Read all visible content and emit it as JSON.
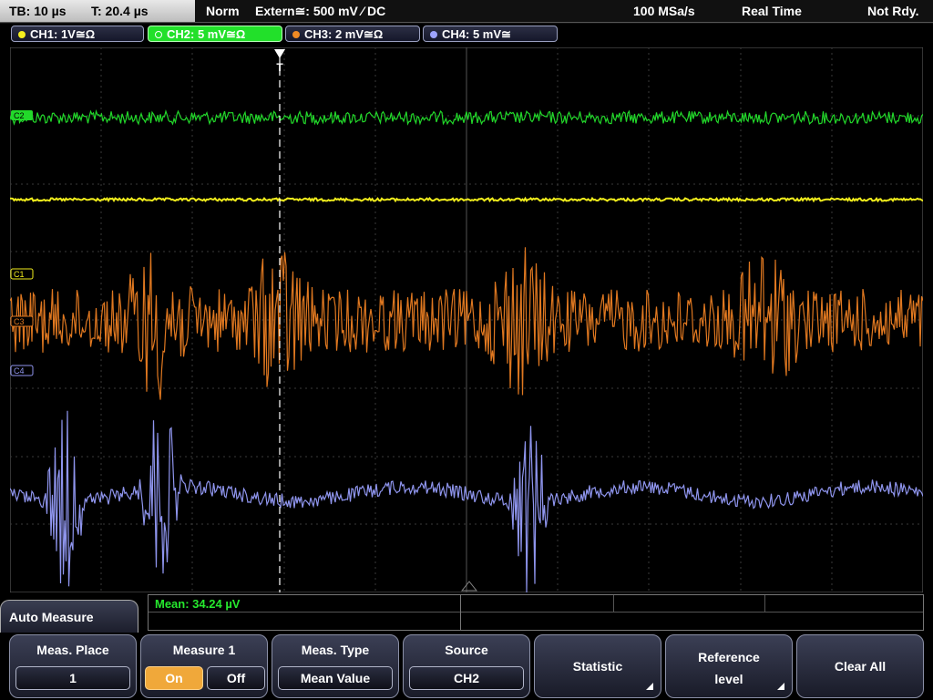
{
  "top": {
    "tb": "TB: 10 µs",
    "trigger_time": "T: 20.4 µs",
    "mode": "Norm",
    "trigger_source": "Extern≅: 500 mV ⁄ DC",
    "sample_rate": "100 MSa/s",
    "acq_mode": "Real Time",
    "status": "Not Rdy."
  },
  "channels": [
    {
      "label": "CH1: 1V≅Ω",
      "color": "#f5ef1e",
      "active": false
    },
    {
      "label": "CH2: 5 mV≅Ω",
      "color": "#22e02a",
      "active": true
    },
    {
      "label": "CH3: 2 mV≅Ω",
      "color": "#f08a24",
      "active": false
    },
    {
      "label": "CH4: 5 mV≅",
      "color": "#9da3ff",
      "active": false
    }
  ],
  "markers": {
    "c2": "C2",
    "c1": "C1",
    "c3": "C3",
    "c4": "C4",
    "trigger": "T"
  },
  "measurement": {
    "mean": "Mean: 34.24 µV"
  },
  "menu": {
    "title": "Auto Measure",
    "meas_place": {
      "title": "Meas. Place",
      "value": "1"
    },
    "measure1": {
      "title": "Measure 1",
      "on": "On",
      "off": "Off"
    },
    "meas_type": {
      "title": "Meas. Type",
      "value": "Mean Value"
    },
    "source": {
      "title": "Source",
      "value": "CH2"
    },
    "statistic": "Statistic",
    "reference_l1": "Reference",
    "reference_l2": "level",
    "clear_all": "Clear All"
  }
}
